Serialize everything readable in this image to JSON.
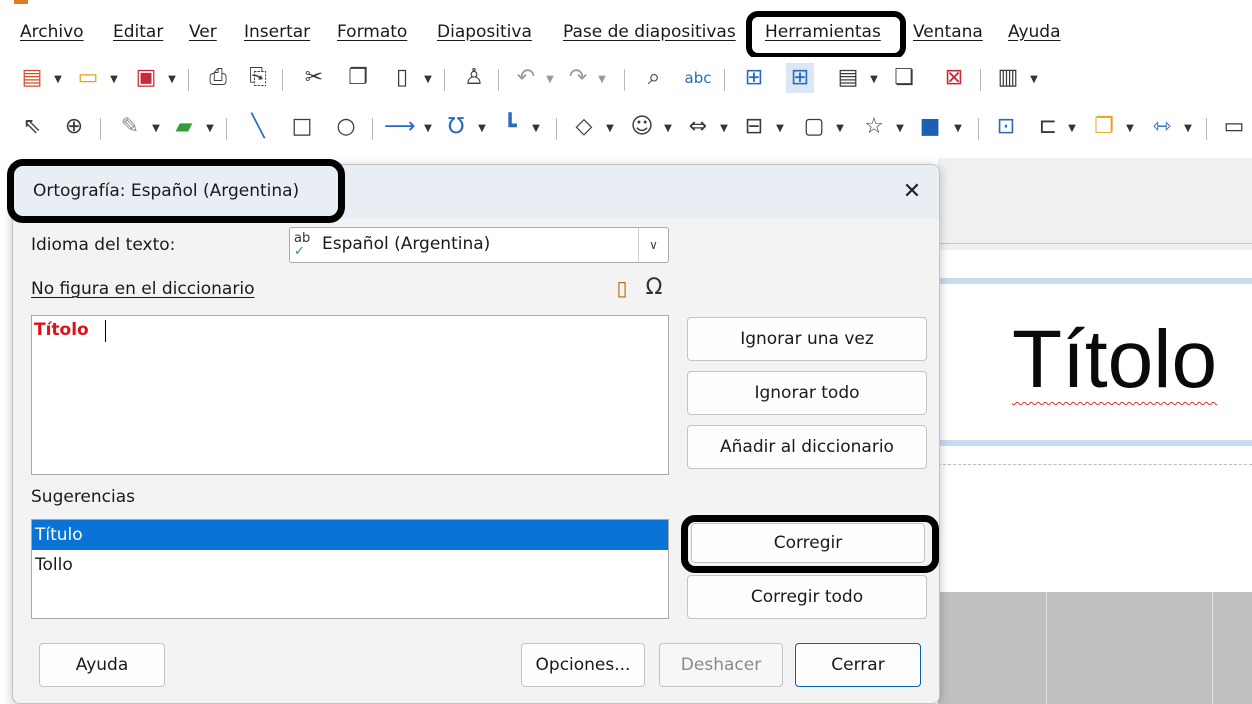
{
  "menu": {
    "items": [
      "Archivo",
      "Editar",
      "Ver",
      "Insertar",
      "Formato",
      "Diapositiva",
      "Pase de diapositivas",
      "Herramientas",
      "Ventana",
      "Ayuda"
    ]
  },
  "toolbar1": {
    "icons": [
      "new-document-icon",
      "open-folder-icon",
      "save-icon",
      "export-pdf-icon",
      "print-icon",
      "cut-icon",
      "copy-icon",
      "paste-icon",
      "clone-formatting-icon",
      "undo-icon",
      "redo-icon",
      "find-replace-icon",
      "spelling-icon",
      "grid-display-icon",
      "snap-to-grid-icon",
      "textbox-icon",
      "insert-table-icon",
      "delete-icon",
      "presentation-layout-icon"
    ]
  },
  "toolbar2": {
    "icons": [
      "select-icon",
      "zoom-icon",
      "line-color-icon",
      "fill-color-icon",
      "line-icon",
      "rectangle-icon",
      "ellipse-icon",
      "arrow-icon",
      "curve-icon",
      "connector-icon",
      "diamond-icon",
      "smiley-icon",
      "double-arrow-icon",
      "flowchart-icon",
      "callout-icon",
      "star-icon",
      "3d-object-icon",
      "transform-icon",
      "align-icon",
      "arrange-icon",
      "distribute-icon",
      "shadow-icon"
    ]
  },
  "slide": {
    "title_text": "Títolo"
  },
  "dialog": {
    "title": "Ortografía: Español (Argentina)",
    "close_symbol": "✕",
    "language_label": "Idioma del texto:",
    "language_value": "Español (Argentina)",
    "language_icon_text": "ab",
    "not_in_dictionary_label": "No figura en el diccionario",
    "error_word": "Títolo",
    "suggestions_label": "Sugerencias",
    "suggestions": [
      "Título",
      "Tollo"
    ],
    "selected_suggestion_index": 0,
    "buttons": {
      "ignore_once": "Ignorar una vez",
      "ignore_all": "Ignorar todo",
      "add_to_dictionary": "Añadir al diccionario",
      "correct": "Corregir",
      "correct_all": "Corregir todo",
      "help": "Ayuda",
      "options": "Opciones...",
      "undo": "Deshacer",
      "close": "Cerrar"
    }
  },
  "colors": {
    "selection": "#0a74d6",
    "error_text": "#e0101a",
    "highlight_outline": "#000000"
  }
}
